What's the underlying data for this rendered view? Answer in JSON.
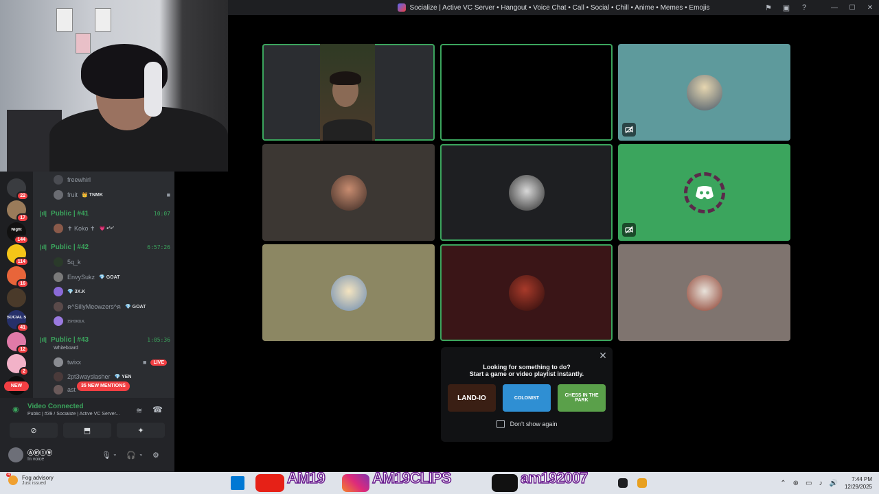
{
  "window": {
    "title": "Socialize | Active VC Server • Hangout • Voice Chat • Call • Social • Chill • Anime • Memes • Emojis",
    "toolbar_icons": [
      "inbox-flag-icon",
      "screen-icon",
      "help-icon"
    ],
    "controls": [
      "minimize",
      "maximize",
      "close"
    ]
  },
  "guilds": [
    {
      "badge": "22",
      "color": "#3a3c40"
    },
    {
      "badge": "17",
      "color": "#9a7b5a"
    },
    {
      "badge": "144",
      "color": "#111111",
      "label": "Night"
    },
    {
      "badge": "114",
      "color": "#f5c518"
    },
    {
      "badge": "16",
      "color": "#e8653a"
    },
    {
      "badge": "",
      "color": "#4a3a2a"
    },
    {
      "badge": "41",
      "color": "#26306a",
      "label": "SOCIAL STE"
    },
    {
      "badge": "12",
      "color": "#e07aa8"
    },
    {
      "badge": "2",
      "color": "#f2b2c8"
    },
    {
      "badge": "",
      "color": "#0c0c0c"
    }
  ],
  "new_pill": "NEW",
  "channels": {
    "top_users": [
      {
        "name": "freewhirl",
        "tag": ""
      },
      {
        "name": "fruit",
        "tag": "👑 TNMK"
      }
    ],
    "vc41": {
      "name": "Public | #41",
      "timer": "10:07",
      "users": [
        {
          "name": "✝ Koko ✝",
          "tag": "💗 •ᐟ•ᐟ"
        }
      ]
    },
    "vc42": {
      "name": "Public | #42",
      "timer": "6:57:26",
      "users": [
        {
          "name": "5q_k",
          "tag": ""
        },
        {
          "name": "EnvySukz",
          "tag": "💎 GOAT"
        },
        {
          "name": "",
          "tag": "💎 3X.K"
        },
        {
          "name": "ฅ^SillyMeowzers^ฅ",
          "tag": "💎 GOAT"
        },
        {
          "name": "ɪsʜɪᴋɪʟᴋ.",
          "tag": ""
        }
      ]
    },
    "vc43": {
      "name": "Public | #43",
      "timer": "1:05:36",
      "activity": "Whiteboard",
      "users": [
        {
          "name": "twixx",
          "tag": "",
          "live": "LIVE"
        },
        {
          "name": "2pt3wayslasher",
          "tag": "💎 YEN"
        },
        {
          "name": "ast",
          "tag": ""
        }
      ]
    },
    "mentions": "35 NEW MENTIONS"
  },
  "voice_panel": {
    "status": "Video Connected",
    "channel": "Public | #39 / Socialize | Active VC Server...",
    "buttons": [
      "camera-off",
      "screen-share",
      "activities"
    ],
    "user": {
      "name": "Ⓐⓜ①⑨",
      "status": "In voice"
    }
  },
  "tiles": [
    {
      "bg": "#2b2d31",
      "speaking": true,
      "kind": "video"
    },
    {
      "bg": "#000000",
      "speaking": true,
      "kind": "blank"
    },
    {
      "bg": "#5e9a9c",
      "speaking": false,
      "kind": "avatar",
      "icon": "camera-off-icon"
    },
    {
      "bg": "#3c3733",
      "speaking": false,
      "kind": "avatar"
    },
    {
      "bg": "#1e1f22",
      "speaking": true,
      "kind": "avatar"
    },
    {
      "bg": "#3ba55d",
      "speaking": false,
      "kind": "discord",
      "icon": "video-off-icon"
    },
    {
      "bg": "#8c8763",
      "speaking": false,
      "kind": "avatar"
    },
    {
      "bg": "#3a1517",
      "speaking": true,
      "kind": "avatar"
    },
    {
      "bg": "#7f746f",
      "speaking": false,
      "kind": "avatar"
    }
  ],
  "activity_popup": {
    "line1": "Looking for something to do?",
    "line2": "Start a game or video playlist instantly.",
    "games": [
      {
        "label": "LAND-IO",
        "color": "#3a1f14"
      },
      {
        "label": "COLONIST",
        "color": "#2f8fd3"
      },
      {
        "label": "CHESS IN THE PARK",
        "color": "#5aa04a"
      }
    ],
    "checkbox_label": "Don't show again"
  },
  "taskbar": {
    "weather_badge": "4",
    "weather_title": "Fog advisory",
    "weather_sub": "Just issued",
    "overlay_texts": [
      "AM19",
      "AM19CLIPS",
      "am192007"
    ],
    "clock_time": "7:44 PM",
    "clock_date": "12/29/2025"
  }
}
